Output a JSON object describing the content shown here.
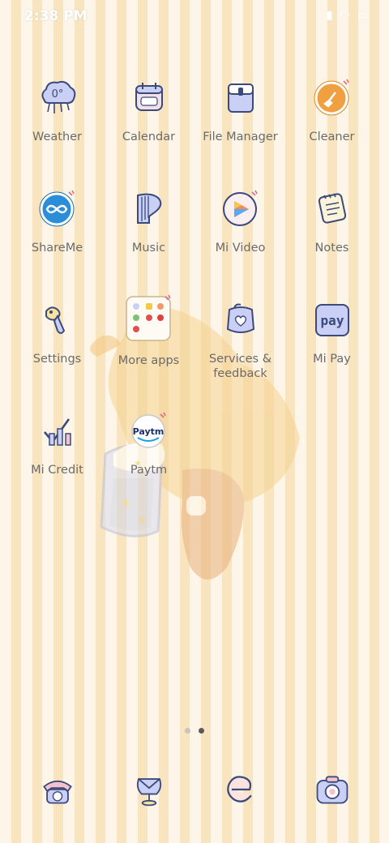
{
  "status_bar": {
    "time": "2:38 PM"
  },
  "home": {
    "apps": [
      {
        "label": "Weather",
        "icon": "weather-cloud-icon"
      },
      {
        "label": "Calendar",
        "icon": "calendar-icon"
      },
      {
        "label": "File Manager",
        "icon": "folder-icon"
      },
      {
        "label": "Cleaner",
        "icon": "broom-icon"
      },
      {
        "label": "ShareMe",
        "icon": "infinity-share-icon"
      },
      {
        "label": "Music",
        "icon": "harp-icon"
      },
      {
        "label": "Mi Video",
        "icon": "play-icon"
      },
      {
        "label": "Notes",
        "icon": "notepad-icon"
      },
      {
        "label": "Settings",
        "icon": "paintbrush-settings-icon"
      },
      {
        "label": "More apps",
        "icon": "folder-grid-icon"
      },
      {
        "label": "Services & feedback",
        "icon": "heart-bag-icon"
      },
      {
        "label": "Mi Pay",
        "icon": "pay-icon"
      },
      {
        "label": "Mi Credit",
        "icon": "credit-chart-icon"
      },
      {
        "label": "Paytm",
        "icon": "paytm-logo-icon"
      }
    ],
    "weather_icon_text": "0°",
    "pay_icon_text": "pay",
    "paytm_icon_text": "Paytm"
  },
  "pager": {
    "pages": 2,
    "active_index": 1
  },
  "dock": [
    {
      "icon": "phone-icon"
    },
    {
      "icon": "message-icon"
    },
    {
      "icon": "browser-icon"
    },
    {
      "icon": "camera-icon"
    }
  ],
  "colors": {
    "stripe_light": "#fdf6e8",
    "stripe_dark": "#f8e5c0",
    "icon_outline": "#3b4a7a",
    "icon_fill": "#c9cff5",
    "label": "#6a6a6a"
  }
}
